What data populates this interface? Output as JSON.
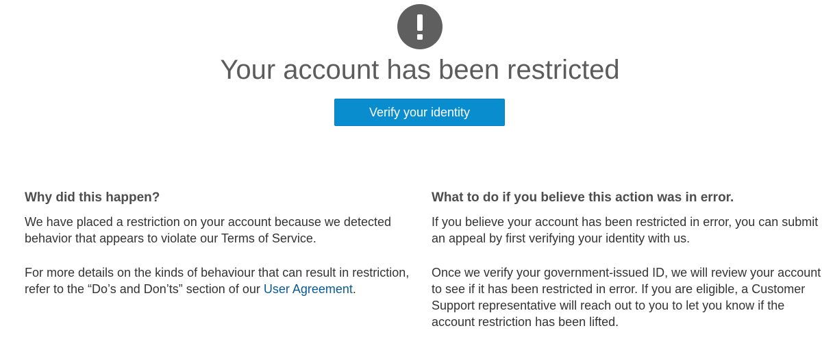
{
  "header": {
    "icon": "exclamation-alert-icon",
    "icon_glyph": "!",
    "icon_color": "#5f5f5f",
    "title": "Your account has been restricted"
  },
  "verify_button": {
    "label": "Verify your identity",
    "color": "#0a8dcf"
  },
  "why_section": {
    "heading": "Why did this happen?",
    "paragraph1": "We have placed a restriction on your account because we detected behavior that appears to violate our Terms of Service.",
    "paragraph2_prefix": "For more details on the kinds of behaviour that can result in restriction, refer to the “Do’s and Don’ts” section of our ",
    "paragraph2_link": "User Agreement",
    "paragraph2_suffix": "."
  },
  "error_section": {
    "heading": "What to do if you believe this action was in error.",
    "paragraph1": "If you believe your account has been restricted in error, you can submit an appeal by first verifying your identity with us.",
    "paragraph2": "Once we verify your government-issued ID, we will review your account to see if it has been restricted in error. If you are eligible, a Customer Support representative will reach out to you to let you know if the account restriction has been lifted."
  },
  "link_color": "#0a5a94"
}
